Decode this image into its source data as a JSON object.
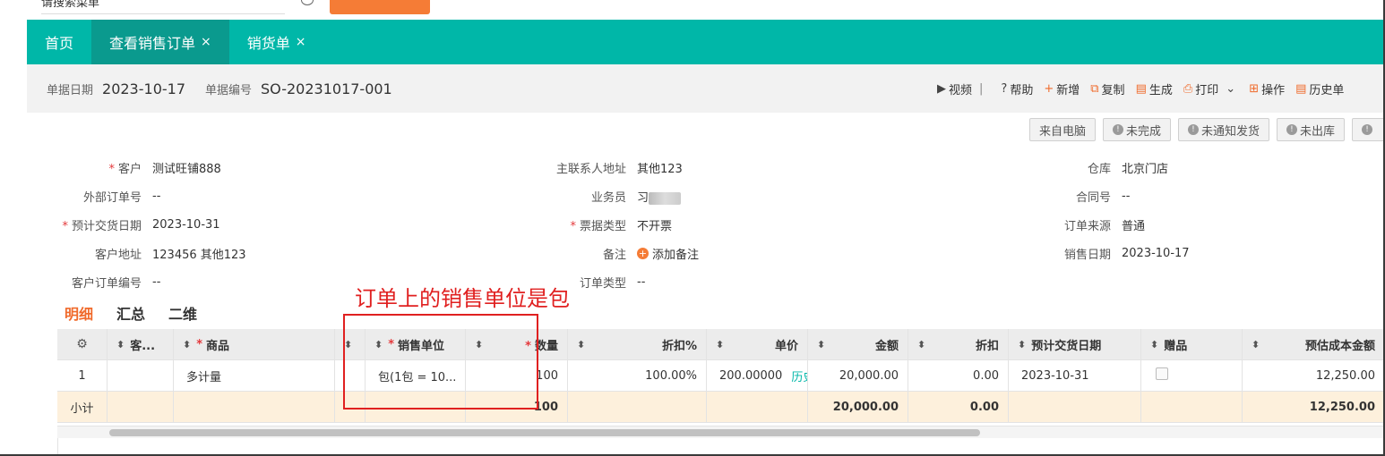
{
  "top": {
    "search_value": "请搜索菜单"
  },
  "tabs": [
    {
      "label": "首页",
      "closable": false
    },
    {
      "label": "查看销售订单",
      "closable": true
    },
    {
      "label": "销货单",
      "closable": true
    }
  ],
  "close_glyph": "×",
  "header": {
    "date_label": "单据日期",
    "date_value": "2023-10-17",
    "number_label": "单据编号",
    "number_value": "SO-20231017-001",
    "actions": {
      "video": "视频",
      "help": "帮助",
      "new": "新增",
      "copy": "复制",
      "generate": "生成",
      "print": "打印",
      "operate": "操作",
      "history": "历史单"
    }
  },
  "status_badges": [
    "来自电脑",
    "未完成",
    "未通知发货",
    "未出库"
  ],
  "fields": {
    "customer_label": "客户",
    "customer_value": "测试旺铺888",
    "ext_order_label": "外部订单号",
    "ext_order_value": "--",
    "delivery_label": "预计交货日期",
    "delivery_value": "2023-10-31",
    "cust_addr_label": "客户地址",
    "cust_addr_value": "123456 其他123",
    "cust_order_label": "客户订单编号",
    "cust_order_value": "--",
    "contact_addr_label": "主联系人地址",
    "contact_addr_value": "其他123",
    "salesman_label": "业务员",
    "salesman_value": "习",
    "invoice_label": "票据类型",
    "invoice_value": "不开票",
    "remark_label": "备注",
    "remark_value": "添加备注",
    "order_type_label": "订单类型",
    "order_type_value": "--",
    "warehouse_label": "仓库",
    "warehouse_value": "北京门店",
    "contract_label": "合同号",
    "contract_value": "--",
    "source_label": "订单来源",
    "source_value": "普通",
    "sale_date_label": "销售日期",
    "sale_date_value": "2023-10-17"
  },
  "subtabs": [
    "明细",
    "汇总",
    "二维"
  ],
  "annotation": "订单上的销售单位是包",
  "grid": {
    "headers": {
      "customer_code": "客...",
      "product": "商品",
      "sale_unit": "销售单位",
      "quantity": "数量",
      "discount_pct": "折扣%",
      "unit_price": "单价",
      "amount": "金额",
      "discount": "折扣",
      "delivery_date": "预计交货日期",
      "gift": "赠品",
      "est_cost": "预估成本金额"
    },
    "row": {
      "index": "1",
      "product": "多计量",
      "sale_unit": "包(1包 = 10...",
      "quantity": "100",
      "discount_pct": "100.00%",
      "unit_price": "200.00000",
      "history": "历史",
      "amount": "20,000.00",
      "discount": "0.00",
      "delivery_date": "2023-10-31",
      "est_cost": "12,250.00"
    },
    "subtotal": {
      "label": "小计",
      "quantity": "100",
      "amount": "20,000.00",
      "discount": "0.00",
      "est_cost": "12,250.00"
    }
  },
  "colors": {
    "teal": "#00b7a8",
    "orange": "#f06a2b",
    "red": "#e02020"
  }
}
